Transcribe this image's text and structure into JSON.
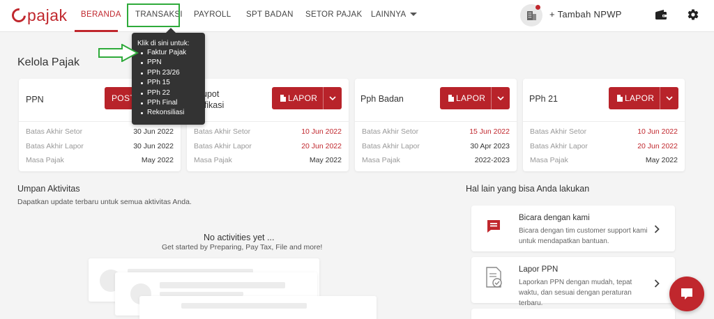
{
  "logo": {
    "text": "pajak"
  },
  "nav": {
    "items": [
      {
        "label": "BERANDA"
      },
      {
        "label": "TRANSAKSI"
      },
      {
        "label": "PAYROLL"
      },
      {
        "label": "SPT BADAN"
      },
      {
        "label": "SETOR PAJAK"
      },
      {
        "label": "LAINNYA"
      }
    ],
    "active": "BERANDA",
    "tambah_npwp": "+ Tambah NPWP"
  },
  "tooltip": {
    "title": "Klik di sini untuk:",
    "items": [
      "Faktur Pajak",
      "PPN",
      "PPh 23/26",
      "PPh 15",
      "PPh 22",
      "PPh Final",
      "Rekonsiliasi"
    ]
  },
  "kelola": {
    "title": "Kelola Pajak",
    "cards": [
      {
        "name": "PPN",
        "button": "POST",
        "rows": [
          {
            "label": "Batas Akhir Setor",
            "value": "30 Jun 2022",
            "highlight": false
          },
          {
            "label": "Batas Akhir Lapor",
            "value": "30 Jun 2022",
            "highlight": false
          },
          {
            "label": "Masa Pajak",
            "value": "May 2022",
            "highlight": false
          }
        ]
      },
      {
        "name_line1": "upot",
        "name_line2": "ifikasi",
        "button": "LAPOR",
        "rows": [
          {
            "label": "Batas Akhir Setor",
            "value": "10 Jun 2022",
            "highlight": true
          },
          {
            "label": "Batas Akhir Lapor",
            "value": "20 Jun 2022",
            "highlight": true
          },
          {
            "label": "Masa Pajak",
            "value": "May 2022",
            "highlight": false
          }
        ]
      },
      {
        "name": "Pph Badan",
        "button": "LAPOR",
        "rows": [
          {
            "label": "Batas Akhir Setor",
            "value": "15 Jun 2022",
            "highlight": true
          },
          {
            "label": "Batas Akhir Lapor",
            "value": "30 Apr 2023",
            "highlight": false
          },
          {
            "label": "Masa Pajak",
            "value": "2022-2023",
            "highlight": false
          }
        ]
      },
      {
        "name": "PPh 21",
        "button": "LAPOR",
        "rows": [
          {
            "label": "Batas Akhir Setor",
            "value": "10 Jun 2022",
            "highlight": true
          },
          {
            "label": "Batas Akhir Lapor",
            "value": "20 Jun 2022",
            "highlight": true
          },
          {
            "label": "Masa Pajak",
            "value": "May 2022",
            "highlight": false
          }
        ]
      }
    ]
  },
  "umpan": {
    "title": "Umpan Aktivitas",
    "subtitle": "Dapatkan update terbaru untuk semua aktivitas Anda.",
    "empty_title": "No activities yet ...",
    "empty_subtitle": "Get started by Preparing, Pay Tax, File and more!"
  },
  "hal_lain": {
    "title": "Hal lain yang bisa Anda lakukan",
    "items": [
      {
        "title": "Bicara dengan kami",
        "desc": "Bicara dengan tim customer support kami untuk mendapatkan bantuan.",
        "icon": "chat-icon"
      },
      {
        "title": "Lapor PPN",
        "desc": "Laporkan PPN dengan mudah, tepat waktu, dan sesuai dengan peraturan terbaru.",
        "icon": "document-check-icon"
      }
    ]
  },
  "colors": {
    "brand": "#c0272d",
    "highlight": "#2eaa3a"
  }
}
